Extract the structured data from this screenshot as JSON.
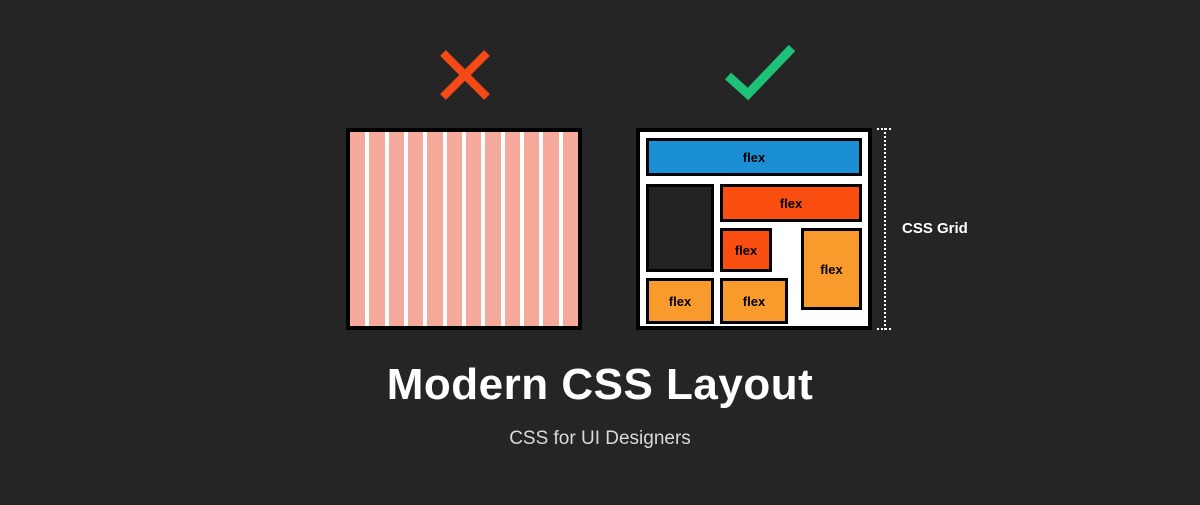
{
  "title": "Modern CSS Layout",
  "subtitle": "CSS for UI Designers",
  "bracket_label": "CSS Grid",
  "colors": {
    "bg": "#252525",
    "cross": "#f54a15",
    "check": "#1ec276",
    "blue": "#1b8fd3",
    "orange": "#fa4e11",
    "amber": "#f89b2c",
    "stripe": "#f4a99a"
  },
  "bad_panel": {
    "column_count": 12,
    "marked": "wrong"
  },
  "good_panel": {
    "marked": "correct",
    "boxes": [
      {
        "id": "top",
        "label": "flex",
        "color": "blue"
      },
      {
        "id": "dark",
        "label": "",
        "color": "dark"
      },
      {
        "id": "row2",
        "label": "flex",
        "color": "orange"
      },
      {
        "id": "sm1",
        "label": "flex",
        "color": "orange"
      },
      {
        "id": "tall",
        "label": "flex",
        "color": "amber"
      },
      {
        "id": "bl1",
        "label": "flex",
        "color": "amber"
      },
      {
        "id": "bl2",
        "label": "flex",
        "color": "amber"
      }
    ]
  }
}
